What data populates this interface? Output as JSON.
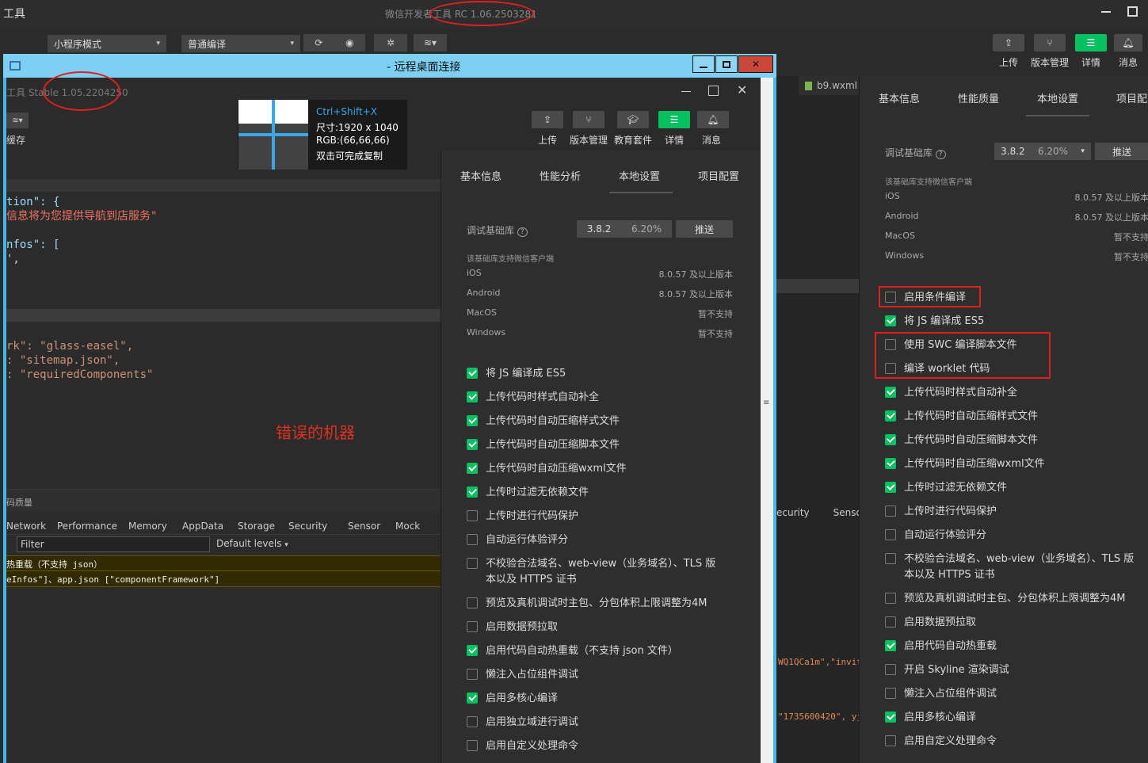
{
  "outer": {
    "title_left": "工具",
    "title_center": "微信开发者工具 RC 1.06.2503281",
    "mode_select": "小程序模式",
    "compile_select": "普通编译",
    "toolbar": [
      "上传",
      "版本管理",
      "详情",
      "消息"
    ],
    "editor_tab": "b9.wxml",
    "tabs": [
      "基本信息",
      "性能质量",
      "本地设置",
      "项目配"
    ],
    "lib_label": "调试基础库",
    "lib_version": "3.8.2",
    "lib_percent": "6.20%",
    "push_label": "推送",
    "support_heading": "该基础库支持微信客户端",
    "support_rows": [
      {
        "os": "iOS",
        "ver": "8.0.57 及以上版本"
      },
      {
        "os": "Android",
        "ver": "8.0.57 及以上版本"
      },
      {
        "os": "MacOS",
        "ver": "暂不支持"
      },
      {
        "os": "Windows",
        "ver": "暂不支持"
      }
    ],
    "settings": [
      {
        "label": "启用条件编译",
        "checked": false
      },
      {
        "label": "将 JS 编译成 ES5",
        "checked": true
      },
      {
        "label": "使用 SWC 编译脚本文件",
        "checked": false
      },
      {
        "label": "编译 worklet 代码",
        "checked": false
      },
      {
        "label": "上传代码时样式自动补全",
        "checked": true
      },
      {
        "label": "上传代码时自动压缩样式文件",
        "checked": true
      },
      {
        "label": "上传代码时自动压缩脚本文件",
        "checked": true
      },
      {
        "label": "上传代码时自动压缩wxml文件",
        "checked": true
      },
      {
        "label": "上传时过滤无依赖文件",
        "checked": true
      },
      {
        "label": "上传时进行代码保护",
        "checked": false
      },
      {
        "label": "自动运行体验评分",
        "checked": false
      },
      {
        "label": "不校验合法域名、web-view（业务域名）、TLS 版",
        "label2": "本以及 HTTPS 证书",
        "checked": false
      },
      {
        "label": "预览及真机调试时主包、分包体积上限调整为4M",
        "checked": false
      },
      {
        "label": "启用数据预拉取",
        "checked": false
      },
      {
        "label": "启用代码自动热重载",
        "checked": true
      },
      {
        "label": "开启 Skyline 渲染调试",
        "checked": false
      },
      {
        "label": "懒注入占位组件调试",
        "checked": false
      },
      {
        "label": "启用多核心编译",
        "checked": true
      },
      {
        "label": "启用自定义处理命令",
        "checked": false
      }
    ],
    "devtools_tabs": [
      "ecurity",
      "Senso"
    ],
    "console_line1": "WQ1QCa1m\",\"invit",
    "console_line2": "\"1735600420\", yj"
  },
  "remote": {
    "title": "- 远程桌面连接",
    "inner_title": "工具 Stable 1.05.2204250",
    "cache_label": "缓存",
    "picker": {
      "shortcut": "Ctrl+Shift+X",
      "size": "尺寸:1920 x 1040",
      "rgb": "RGB:(66,66,66)",
      "copy": "双击可完成复制"
    },
    "toolbar": [
      "上传",
      "版本管理",
      "教育套件",
      "详情",
      "消息"
    ],
    "tabs": [
      "基本信息",
      "性能分析",
      "本地设置",
      "项目配置"
    ],
    "lib_label": "调试基础库",
    "lib_version": "3.8.2",
    "lib_percent": "6.20%",
    "push_label": "推送",
    "support_heading": "该基础库支持微信客户端",
    "support_rows": [
      {
        "os": "iOS",
        "ver": "8.0.57 及以上版本"
      },
      {
        "os": "Android",
        "ver": "8.0.57 及以上版本"
      },
      {
        "os": "MacOS",
        "ver": "暂不支持"
      },
      {
        "os": "Windows",
        "ver": "暂不支持"
      }
    ],
    "settings": [
      {
        "label": "将 JS 编译成 ES5",
        "checked": true
      },
      {
        "label": "上传代码时样式自动补全",
        "checked": true
      },
      {
        "label": "上传代码时自动压缩样式文件",
        "checked": true
      },
      {
        "label": "上传代码时自动压缩脚本文件",
        "checked": true
      },
      {
        "label": "上传代码时自动压缩wxml文件",
        "checked": true
      },
      {
        "label": "上传时过滤无依赖文件",
        "checked": true
      },
      {
        "label": "上传时进行代码保护",
        "checked": false
      },
      {
        "label": "自动运行体验评分",
        "checked": false
      },
      {
        "label": "不校验合法域名、web-view（业务域名）、TLS 版",
        "label2": "本以及 HTTPS 证书",
        "checked": false
      },
      {
        "label": "预览及真机调试时主包、分包体积上限调整为4M",
        "checked": false
      },
      {
        "label": "启用数据预拉取",
        "checked": false
      },
      {
        "label": "启用代码自动热重载（不支持 json 文件）",
        "checked": true
      },
      {
        "label": "懒注入占位组件调试",
        "checked": false
      },
      {
        "label": "启用多核心编译",
        "checked": true
      },
      {
        "label": "启用独立域进行调试",
        "checked": false
      },
      {
        "label": "启用自定义处理命令",
        "checked": false
      }
    ],
    "code_lines": [
      {
        "text": "tion\": {",
        "color": "#9cdcfe"
      },
      {
        "text": "信息将为您提供导航到店服务\"",
        "color": "#f07060"
      },
      {
        "text": "",
        "color": "#ccc"
      },
      {
        "text": "nfos\": [",
        "color": "#9cdcfe"
      },
      {
        "text": "',",
        "color": "#ccc"
      }
    ],
    "code_lines2": [
      {
        "text": "rk\": \"glass-easel\",",
        "color": "#ce9178"
      },
      {
        "text": ": \"sitemap.json\",",
        "color": "#ce9178"
      },
      {
        "text": ": \"requiredComponents\"",
        "color": "#ce9178"
      }
    ],
    "annotation": "错误的机器",
    "quality_label": "码质量",
    "devtools_tabs": [
      "Network",
      "Performance",
      "Memory",
      "AppData",
      "Storage",
      "Security",
      "Sensor",
      "Mock"
    ],
    "filter_placeholder": "Filter",
    "levels": "Default levels",
    "warn1": "热重载（不支持 json）",
    "warn2": "eInfos\"]、app.json [\"componentFramework\"]"
  }
}
